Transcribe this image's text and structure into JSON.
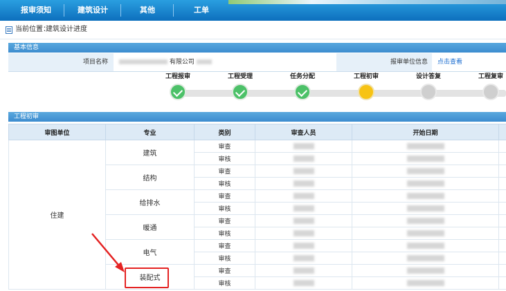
{
  "nav": {
    "items": [
      "报审须知",
      "建筑设计",
      "其他",
      "工单"
    ]
  },
  "breadcrumb": {
    "label": "当前位置：",
    "value": "建筑设计进度"
  },
  "basic_info": {
    "section_title": "基本信息",
    "project_name_label": "项目名称",
    "project_name_visible": "有限公司",
    "unit_info_label": "报审单位信息",
    "view_link": "点击查看"
  },
  "progress": {
    "steps": [
      {
        "label": "工程报审",
        "status": "done"
      },
      {
        "label": "工程受理",
        "status": "done"
      },
      {
        "label": "任务分配",
        "status": "done"
      },
      {
        "label": "工程初审",
        "status": "current"
      },
      {
        "label": "设计答复",
        "status": "pending"
      },
      {
        "label": "工程复审",
        "status": "pending"
      }
    ]
  },
  "review": {
    "section_title": "工程初审",
    "columns": [
      "审图单位",
      "专业",
      "类别",
      "审查人员",
      "开始日期"
    ],
    "unit": "住建",
    "specialties": [
      "建筑",
      "结构",
      "给排水",
      "暖通",
      "电气",
      "装配式"
    ],
    "categories": [
      "审查",
      "审核"
    ]
  },
  "colors": {
    "nav_bg": "#1a86d0",
    "section_header": "#4a9bd8",
    "done": "#4cc168",
    "current": "#f7c314",
    "pending": "#cfcfcf",
    "annotation": "#e42222"
  }
}
